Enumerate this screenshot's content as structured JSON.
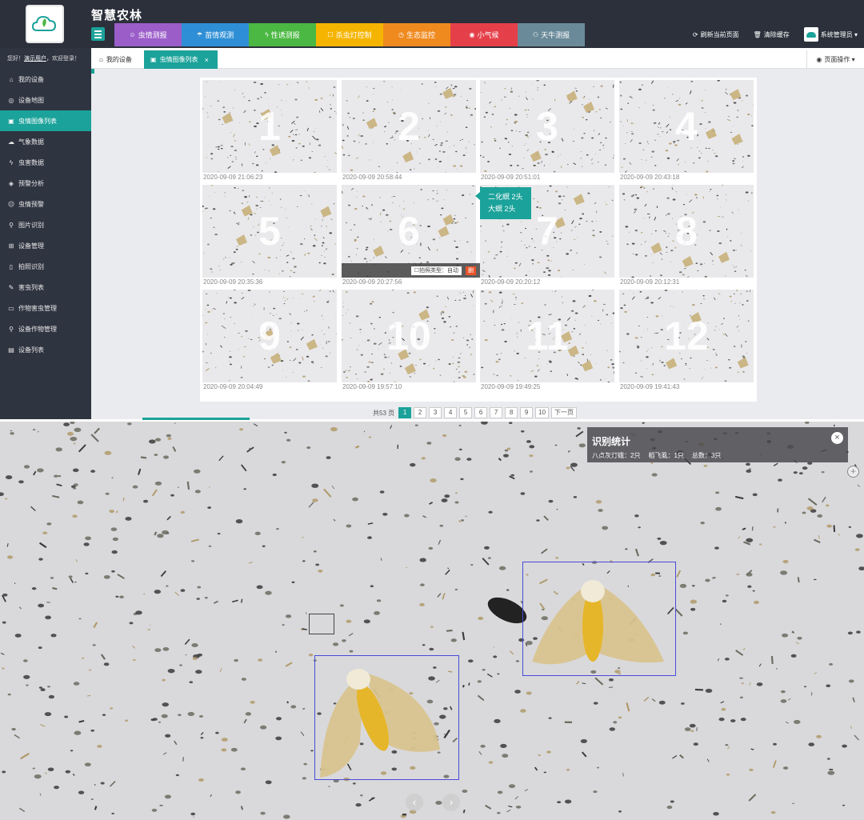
{
  "header": {
    "brand": "智慧农林",
    "nav": [
      {
        "label": "虫情测报",
        "icon": "☺",
        "color": "#9b5ec9",
        "icon_name": "bug-icon"
      },
      {
        "label": "苗情观测",
        "icon": "☂",
        "color": "#2f8fd6",
        "icon_name": "seedling-icon"
      },
      {
        "label": "性诱测报",
        "icon": "ϟ",
        "color": "#4bb843",
        "icon_name": "pheromone-icon"
      },
      {
        "label": "杀虫灯控制",
        "icon": "☐",
        "color": "#f5b400",
        "icon_name": "lamp-icon"
      },
      {
        "label": "生态监控",
        "icon": "◷",
        "color": "#ef8a1f",
        "icon_name": "monitor-icon"
      },
      {
        "label": "小气候",
        "icon": "◉",
        "color": "#e5404a",
        "icon_name": "weather-icon"
      },
      {
        "label": "天牛测报",
        "icon": "⚇",
        "color": "#6a8a99",
        "icon_name": "beetle-icon"
      }
    ],
    "refresh": "刷新当前页面",
    "clear_cache": "清除缓存",
    "user": "系统管理员 ▾"
  },
  "sidebar": {
    "greeting_prefix": "您好！",
    "user_link": "演示用户",
    "greeting_suffix": "欢迎登录！",
    "items": [
      {
        "label": "我的设备",
        "icon": "⌂"
      },
      {
        "label": "设备地图",
        "icon": "◎"
      },
      {
        "label": "虫情图像列表",
        "icon": "▣",
        "active": true
      },
      {
        "label": "气象数据",
        "icon": "☁"
      },
      {
        "label": "虫害数据",
        "icon": "ϟ"
      },
      {
        "label": "预警分析",
        "icon": "◈"
      },
      {
        "label": "虫情预警",
        "icon": "☹"
      },
      {
        "label": "图片识别",
        "icon": "⚲"
      },
      {
        "label": "设备管理",
        "icon": "⊞"
      },
      {
        "label": "拍照识别",
        "icon": "▯"
      },
      {
        "label": "害虫列表",
        "icon": "✎"
      },
      {
        "label": "作物害虫管理",
        "icon": "▭"
      },
      {
        "label": "设备作物管理",
        "icon": "⚲"
      },
      {
        "label": "设备列表",
        "icon": "▤"
      }
    ]
  },
  "tabs": {
    "home": "我的设备",
    "current": "虫情图像列表",
    "close": "×",
    "page_ops": "页面操作 ▾"
  },
  "images": [
    {
      "num": "1",
      "time": "2020-09-09 21:06:23"
    },
    {
      "num": "2",
      "time": "2020-09-09 20:58:44"
    },
    {
      "num": "3",
      "time": "2020-09-09 20:51:01"
    },
    {
      "num": "4",
      "time": "2020-09-09 20:43:18"
    },
    {
      "num": "5",
      "time": "2020-09-09 20:35:36"
    },
    {
      "num": "6",
      "time": "2020-09-09 20:27:56"
    },
    {
      "num": "7",
      "time": "2020-09-09 20:20:12"
    },
    {
      "num": "8",
      "time": "2020-09-09 20:12:31"
    },
    {
      "num": "9",
      "time": "2020-09-09 20:04:49"
    },
    {
      "num": "10",
      "time": "2020-09-09 19:57:10"
    },
    {
      "num": "11",
      "time": "2020-09-09 19:49:25"
    },
    {
      "num": "12",
      "time": "2020-09-09 19:41:43"
    }
  ],
  "hover": {
    "tooltip_line1": "二化螟 2头",
    "tooltip_line2": "大螟 2头",
    "capture_type": "☐拍照类型：自动",
    "delete": "删"
  },
  "pager": {
    "total": "共53 页",
    "pages": [
      "1",
      "2",
      "3",
      "4",
      "5",
      "6",
      "7",
      "8",
      "9",
      "10"
    ],
    "current": "1",
    "next": "下一页"
  },
  "detail": {
    "stats_title": "识别统计",
    "stats": [
      "八点灰灯蛾：2只",
      "稻飞虱：1只",
      "总数：3只"
    ],
    "close": "×",
    "zoom": "+",
    "prev": "‹",
    "next": "›"
  }
}
